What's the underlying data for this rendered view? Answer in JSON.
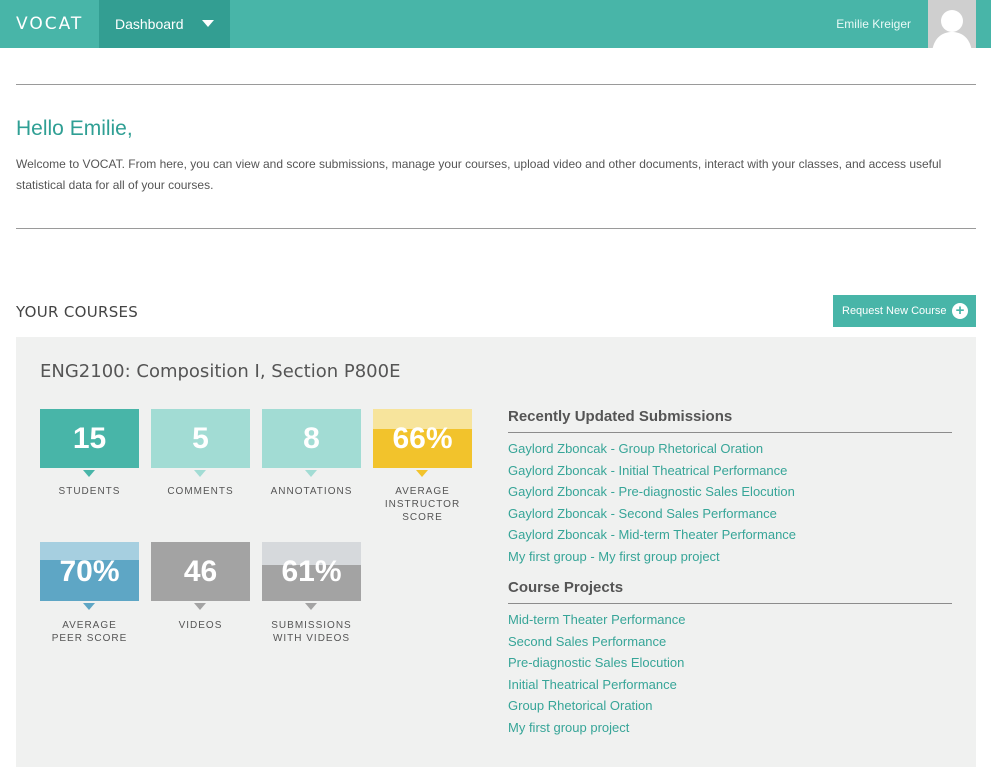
{
  "header": {
    "logo": "VOCAT",
    "nav_label": "Dashboard",
    "user_name": "Emilie Kreiger"
  },
  "greeting": {
    "title": "Hello Emilie,",
    "body": "Welcome to VOCAT. From here, you can view and score submissions, manage your courses, upload video and other documents, interact with your classes, and access useful statistical data for all of your courses."
  },
  "courses_section": {
    "heading": "YOUR COURSES",
    "request_button": "Request New Course"
  },
  "course": {
    "title": "ENG2100: Composition I, Section P800E",
    "stats": [
      {
        "value": "15",
        "label": "STUDENTS",
        "color": "#48b5a8"
      },
      {
        "value": "5",
        "label": "COMMENTS",
        "color": "#a2dcd4"
      },
      {
        "value": "8",
        "label": "ANNOTATIONS",
        "color": "#a2dcd4"
      },
      {
        "value": "66%",
        "label": "AVERAGE INSTRUCTOR SCORE",
        "label_lines": [
          "AVERAGE",
          "INSTRUCTOR",
          "SCORE"
        ],
        "fill_percent": 66,
        "color": "#f2c32c",
        "bg": "#f7e49c"
      },
      {
        "value": "70%",
        "label": "AVERAGE PEER SCORE",
        "label_lines": [
          "AVERAGE",
          "PEER SCORE"
        ],
        "fill_percent": 70,
        "color": "#5ea6c5",
        "bg": "#a6cfe0"
      },
      {
        "value": "46",
        "label": "VIDEOS",
        "color": "#a3a3a3"
      },
      {
        "value": "61%",
        "label": "SUBMISSIONS WITH VIDEOS",
        "label_lines": [
          "SUBMISSIONS",
          "WITH VIDEOS"
        ],
        "fill_percent": 61,
        "color": "#a3a3a3",
        "bg": "#d6d9dc"
      }
    ],
    "recent_heading": "Recently Updated Submissions",
    "recent": [
      "Gaylord Zboncak - Group Rhetorical Oration",
      "Gaylord Zboncak - Initial Theatrical Performance",
      "Gaylord Zboncak - Pre-diagnostic Sales Elocution",
      "Gaylord Zboncak - Second Sales Performance",
      "Gaylord Zboncak - Mid-term Theater Performance",
      "My first group - My first group project"
    ],
    "projects_heading": "Course Projects",
    "projects": [
      "Mid-term Theater Performance",
      "Second Sales Performance",
      "Pre-diagnostic Sales Elocution",
      "Initial Theatrical Performance",
      "Group Rhetorical Oration",
      "My first group project"
    ]
  }
}
